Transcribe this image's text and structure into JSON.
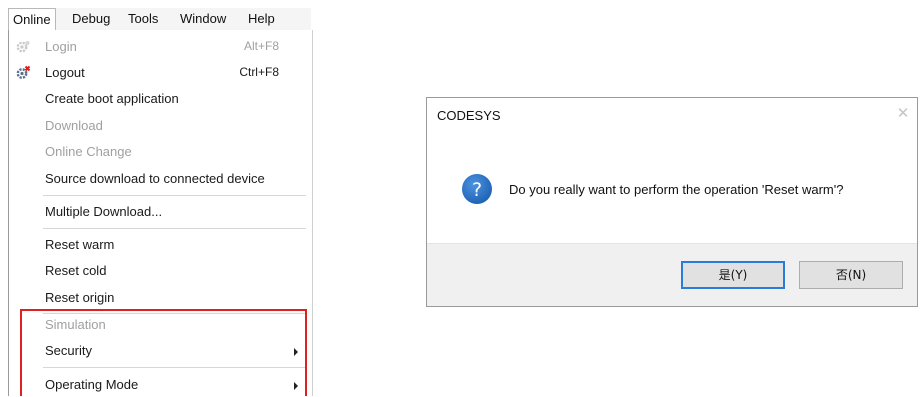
{
  "menubar": {
    "items": [
      "Online",
      "Debug",
      "Tools",
      "Window",
      "Help"
    ],
    "active": "Online"
  },
  "menu": {
    "login": {
      "label": "Login",
      "shortcut": "Alt+F8",
      "icon": "login-gear-icon"
    },
    "logout": {
      "label": "Logout",
      "shortcut": "Ctrl+F8",
      "icon": "logout-gear-icon"
    },
    "create_boot": "Create boot application",
    "download": "Download",
    "online_change": "Online Change",
    "source_download": "Source download to connected device",
    "multiple_download": "Multiple Download...",
    "reset_warm": "Reset warm",
    "reset_cold": "Reset cold",
    "reset_origin": "Reset origin",
    "simulation": "Simulation",
    "security": "Security",
    "operating_mode": "Operating Mode"
  },
  "dialog": {
    "title": "CODESYS",
    "close_icon": "close-icon",
    "icon": "question-icon",
    "message": "Do you really want to perform the operation 'Reset warm'?",
    "yes_label": "是(Y)",
    "no_label": "否(N)"
  },
  "colors": {
    "highlight": "#e02020",
    "default_button_border": "#2b7bd8",
    "question_icon": "#1f64b5"
  }
}
